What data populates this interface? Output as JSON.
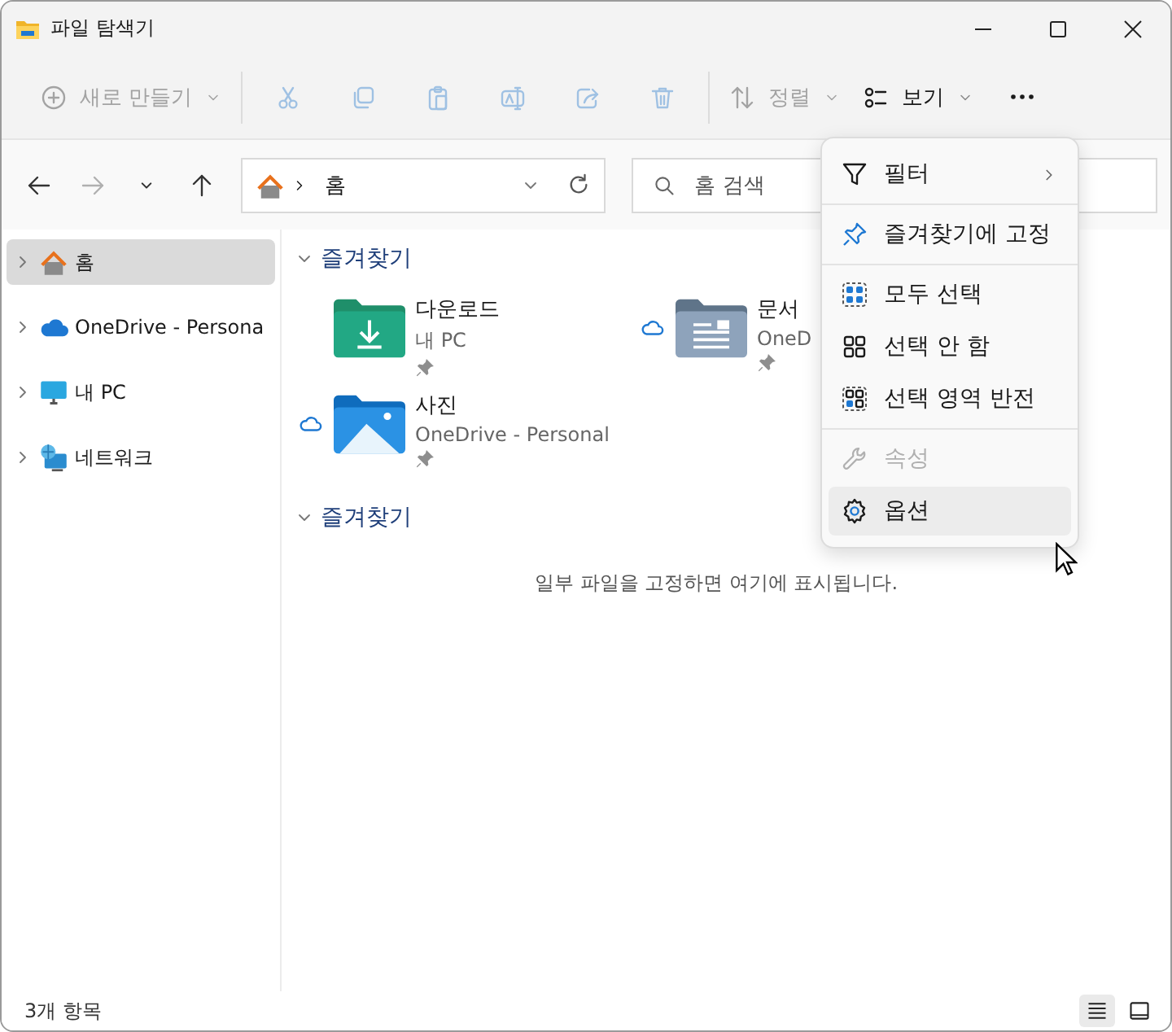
{
  "window": {
    "title": "파일 탐색기"
  },
  "toolbar": {
    "groups": [
      [
        {
          "kind": "new",
          "label": "새로 만들기",
          "dropdown": true,
          "disabled": true
        }
      ],
      [
        {
          "kind": "cut",
          "disabled": true
        },
        {
          "kind": "copy",
          "disabled": true
        },
        {
          "kind": "paste",
          "disabled": true
        },
        {
          "kind": "rename",
          "disabled": true
        },
        {
          "kind": "share",
          "disabled": true
        },
        {
          "kind": "delete",
          "disabled": true
        }
      ],
      [
        {
          "kind": "sort",
          "label": "정렬",
          "dropdown": true,
          "disabled": true
        },
        {
          "kind": "view",
          "label": "보기",
          "dropdown": true,
          "disabled": false
        },
        {
          "kind": "more",
          "disabled": false
        }
      ]
    ]
  },
  "nav": {
    "buttons": [
      {
        "kind": "back",
        "disabled": false
      },
      {
        "kind": "forward",
        "disabled": true
      },
      {
        "kind": "recent",
        "disabled": false
      },
      {
        "kind": "up",
        "disabled": false
      }
    ],
    "address": {
      "location": "홈"
    },
    "search": {
      "placeholder": "홈 검색"
    }
  },
  "sidebar": {
    "items": [
      {
        "kind": "home",
        "label": "홈",
        "selected": true,
        "expanded": false
      },
      {
        "kind": "cloud",
        "label": "OneDrive - Persona",
        "selected": false,
        "expanded": false
      },
      {
        "kind": "pc",
        "label": "내 PC",
        "selected": false,
        "expanded": false
      },
      {
        "kind": "network",
        "label": "네트워크",
        "selected": false,
        "expanded": false
      }
    ]
  },
  "sections": [
    {
      "title": "즐겨찾기",
      "expanded": true,
      "items": [
        {
          "kind": "downloads",
          "name": "다운로드",
          "location": "내 PC",
          "cloud": false,
          "pinned": true
        },
        {
          "kind": "documents",
          "name": "문서",
          "location": "OneD",
          "cloud": true,
          "pinned": true
        },
        {
          "kind": "pictures",
          "name": "사진",
          "location": "OneDrive - Personal",
          "cloud": true,
          "pinned": true
        }
      ]
    },
    {
      "title": "즐겨찾기",
      "expanded": true,
      "empty_text": "일부 파일을 고정하면 여기에 표시됩니다."
    }
  ],
  "menu": {
    "groups": [
      [
        {
          "kind": "filter",
          "label": "필터",
          "submenu": true,
          "disabled": false,
          "selected": false
        }
      ],
      [
        {
          "kind": "pin",
          "label": "즐겨찾기에 고정",
          "submenu": false,
          "disabled": false,
          "selected": false
        }
      ],
      [
        {
          "kind": "select_all",
          "label": "모두 선택",
          "submenu": false,
          "disabled": false,
          "selected": false
        },
        {
          "kind": "select_none",
          "label": "선택 안 함",
          "submenu": false,
          "disabled": false,
          "selected": false
        },
        {
          "kind": "invert",
          "label": "선택 영역 반전",
          "submenu": false,
          "disabled": false,
          "selected": false
        }
      ],
      [
        {
          "kind": "properties",
          "label": "속성",
          "submenu": false,
          "disabled": true,
          "selected": false
        },
        {
          "kind": "options",
          "label": "옵션",
          "submenu": false,
          "disabled": false,
          "selected": true
        }
      ]
    ]
  },
  "status_bar": {
    "text": "3개 항목",
    "views": [
      {
        "kind": "details",
        "selected": true
      },
      {
        "kind": "tiles",
        "selected": false
      }
    ]
  }
}
